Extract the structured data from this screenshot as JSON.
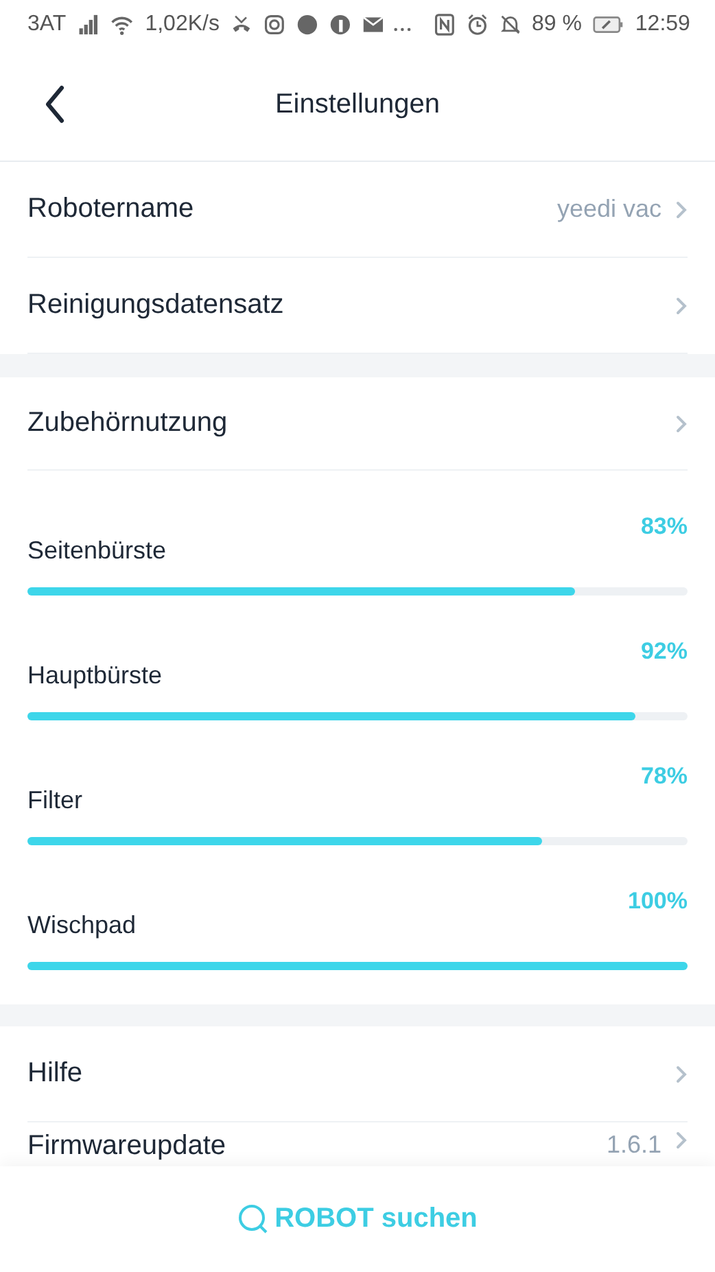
{
  "status_bar": {
    "carrier": "3AT",
    "speed": "1,02K/s",
    "battery": "89 %",
    "time": "12:59"
  },
  "header": {
    "title": "Einstellungen"
  },
  "rows_top": [
    {
      "label": "Robotername",
      "value": "yeedi vac"
    },
    {
      "label": "Reinigungsdatensatz"
    }
  ],
  "accessories": {
    "label": "Zubehörnutzung"
  },
  "consumables": [
    {
      "name": "Seitenbürste",
      "percent": "83%",
      "level": 0.83
    },
    {
      "name": "Hauptbürste",
      "percent": "92%",
      "level": 0.92
    },
    {
      "name": "Filter",
      "percent": "78%",
      "level": 0.78
    },
    {
      "name": "Wischpad",
      "percent": "100%",
      "level": 1
    }
  ],
  "rows_bottom": [
    {
      "label": "Hilfe"
    },
    {
      "label": "Firmwareupdate",
      "value": "1.6.1"
    }
  ],
  "footer": {
    "button": "ROBOT suchen"
  }
}
